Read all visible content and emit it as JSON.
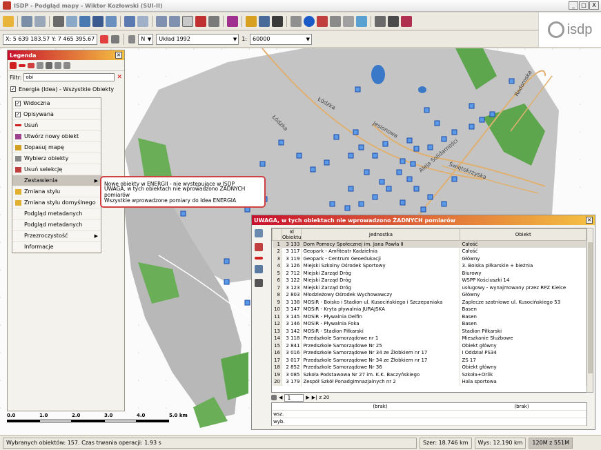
{
  "window": {
    "title": "ISDP - Podgląd mapy - Wiktor Kozłowski (SUI-II)",
    "btn_min": "_",
    "btn_max": "□",
    "btn_close": "X"
  },
  "logo": {
    "text": "isdp"
  },
  "toolbar2": {
    "coords": "X: 5 639 183.57  Y: 7 465 395.67",
    "north": "N",
    "crs": "Układ 1992",
    "scale_prefix": "1:",
    "scale_value": "60000"
  },
  "legend": {
    "title": "Legenda",
    "filter_label": "Filtr:",
    "filter_value": "obi",
    "layer": "Energia (Idea) - Wszystkie Obiekty"
  },
  "menu": {
    "items": [
      {
        "label": "Widoczna",
        "icon": "check-icon"
      },
      {
        "label": "Opisywana",
        "icon": "check-icon"
      },
      {
        "label": "Usuń",
        "icon": "delete-icon"
      },
      {
        "label": "Utwórz nowy obiekt",
        "icon": "new-object-icon"
      },
      {
        "label": "Dopasuj mapę",
        "icon": "zoom-fit-icon"
      },
      {
        "label": "Wybierz obiekty",
        "icon": "filter-icon"
      },
      {
        "label": "Usuń selekcję",
        "icon": "clear-selection-icon"
      },
      {
        "label": "Zestawienia",
        "icon": "",
        "submenu": true
      },
      {
        "label": "Zmiana stylu",
        "icon": "style-icon"
      },
      {
        "label": "Zmiana stylu domyślnego",
        "icon": "style-icon"
      },
      {
        "label": "Podgląd metadanych",
        "icon": ""
      },
      {
        "label": "Podgląd metadanych",
        "icon": ""
      },
      {
        "label": "Przezroczystość",
        "icon": "",
        "submenu": true
      },
      {
        "label": "Informacje",
        "icon": ""
      }
    ]
  },
  "submenu": {
    "items": [
      "Nowe obiekty w ENERGII - nie występujące w ISDP",
      "UWAGA, w tych obiektach nie wprowadzono ŻADNYCH pomiarów",
      "Wszystkie wprowadzone pomiary do Idea ENERGIA"
    ]
  },
  "scale_bar": {
    "labels": [
      "0.0",
      "1.0",
      "2.0",
      "3.0",
      "4.0",
      "5.0 km"
    ]
  },
  "map": {
    "road_labels": [
      "Łódzka",
      "Łódzka",
      "Jesionowa",
      "Aleja Solidarności",
      "Świętokrzyska",
      "Radomska"
    ]
  },
  "grid": {
    "title": "UWAGA, w tych obiektach nie wprowadzono ŻADNYCH pomiarów",
    "columns": [
      "Id Obiektu",
      "Jednostka",
      "Obiekt"
    ],
    "rows": [
      [
        "1",
        "3 133",
        "Dom Pomocy Społecznej im. Jana Pawła II",
        "Całość"
      ],
      [
        "2",
        "3 117",
        "Geopark - Amfiteatr Kadzielnia",
        "Całość"
      ],
      [
        "3",
        "3 119",
        "Geopark - Centrum Geoedukacji",
        "Główny"
      ],
      [
        "4",
        "3 126",
        "Miejski Szkolny Ośrodek Sportowy",
        "3. Boiska piłkarskie + bieżnia"
      ],
      [
        "5",
        "2 712",
        "Miejski Zarząd Dróg",
        "Biurowy"
      ],
      [
        "6",
        "3 122",
        "Miejski Zarząd Dróg",
        "WSPP Kościuszki 14"
      ],
      [
        "7",
        "3 123",
        "Miejski Zarząd Dróg",
        "usługowy - wynajmowany przez RPZ Kielce"
      ],
      [
        "8",
        "2 803",
        "Młodzieżowy Ośrodek Wychowawczy",
        "Główny"
      ],
      [
        "9",
        "3 138",
        "MOSiR - Boisko i Stadion ul. Kusocińskiego i Szczepaniaka",
        "Zaplecze szatniowe ul. Kusocińskiego 53"
      ],
      [
        "10",
        "3 147",
        "MOSiR - Kryta pływalnia JURAJSKA",
        "Basen"
      ],
      [
        "11",
        "3 145",
        "MOSiR - Pływalnia Delfin",
        "Basen"
      ],
      [
        "12",
        "3 146",
        "MOSiR - Pływalnia Foka",
        "Basen"
      ],
      [
        "13",
        "3 142",
        "MOSiR - Stadion Piłkarski",
        "Stadion Piłkarski"
      ],
      [
        "14",
        "3 118",
        "Przedszkole Samorządowe nr 1",
        "Mieszkanie Służbowe"
      ],
      [
        "15",
        "2 841",
        "Przedszkole Samorządowe Nr 25",
        "Obiekt główny"
      ],
      [
        "16",
        "3 016",
        "Przedszkole Samorządowe Nr 34 ze Żłobkiem nr 17",
        "I Oddział PS34"
      ],
      [
        "17",
        "3 017",
        "Przedszkole Samorządowe Nr 34 ze Żłobkiem nr 17",
        "ZS 17"
      ],
      [
        "18",
        "2 852",
        "Przedszkole Samorządowe Nr 36",
        "Obiekt główny"
      ],
      [
        "19",
        "3 085",
        "Szkoła Podstawowa Nr 27 im. K.K. Baczyńskiego",
        "Szkoła+Orlik"
      ],
      [
        "20",
        "3 179",
        "Zespół Szkół Ponadgimnazjalnych nr 2",
        "Hala sportowa"
      ]
    ],
    "page_current": "1",
    "page_total": "z 20",
    "footer_empty": "(brak)",
    "footer_row1": "wsz.",
    "footer_row2": "wyb."
  },
  "status": {
    "message": "Wybranych obiektów: 157. Czas trwania operacji: 1.93 s",
    "width": "Szer: 18.746 km",
    "height": "Wys: 12.190 km",
    "memory": "120M z 551M"
  }
}
